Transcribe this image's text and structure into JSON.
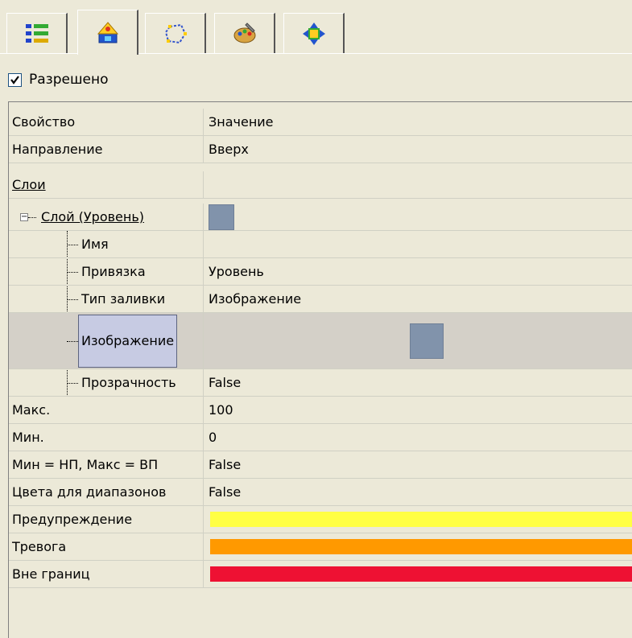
{
  "tabs": [
    {
      "icon": "list-icon",
      "active": false
    },
    {
      "icon": "appearance-icon",
      "active": true
    },
    {
      "icon": "shape-icon",
      "active": false
    },
    {
      "icon": "palette-icon",
      "active": false
    },
    {
      "icon": "move-icon",
      "active": false
    }
  ],
  "enabled": {
    "label": "Разрешено",
    "checked": true
  },
  "grid": {
    "header": {
      "property": "Свойство",
      "value": "Значение"
    },
    "rows": [
      {
        "name": "Направление",
        "value": "Вверх"
      },
      {
        "name": "Слои",
        "value": ""
      },
      {
        "name": "Слой (Уровень)",
        "value": ""
      },
      {
        "name": "Имя",
        "value": ""
      },
      {
        "name": "Привязка",
        "value": "Уровень"
      },
      {
        "name": "Тип заливки",
        "value": "Изображение"
      },
      {
        "name": "Изображение",
        "value": ""
      },
      {
        "name": "Прозрачность",
        "value": "False"
      },
      {
        "name": "Макс.",
        "value": "100"
      },
      {
        "name": "Мин.",
        "value": "0"
      },
      {
        "name": "Мин = НП, Макс = ВП",
        "value": "False"
      },
      {
        "name": "Цвета для диапазонов",
        "value": "False"
      },
      {
        "name": "Предупреждение",
        "value": "",
        "color": "#ffff44"
      },
      {
        "name": "Тревога",
        "value": "",
        "color": "#ff9900"
      },
      {
        "name": "Вне границ",
        "value": "",
        "color": "#ee1133"
      }
    ]
  }
}
